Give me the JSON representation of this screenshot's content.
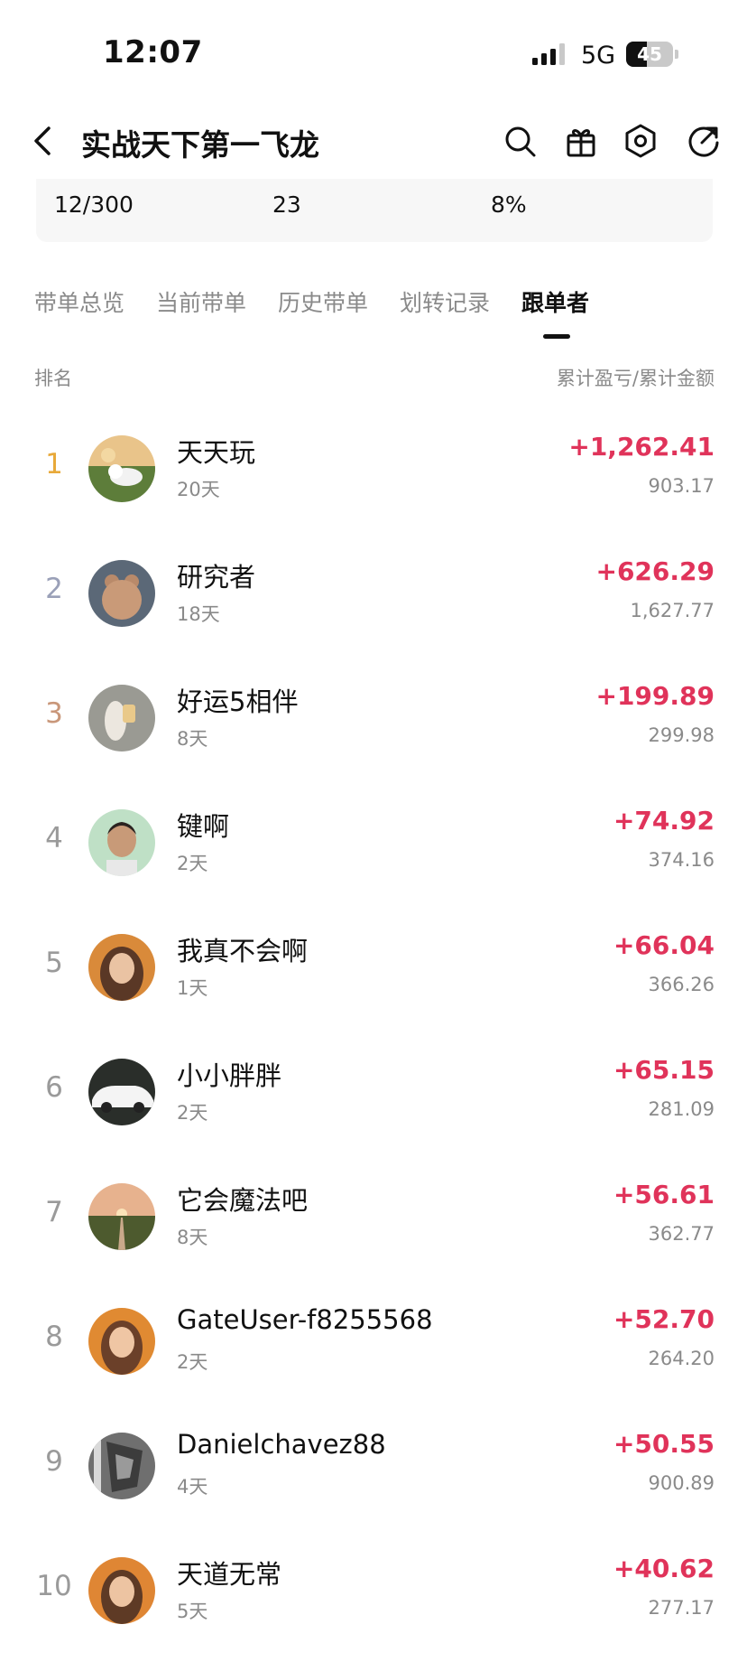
{
  "status_bar": {
    "time": "12:07",
    "network": "5G",
    "battery": "45",
    "battery_level": 0.45
  },
  "header": {
    "title": "实战天下第一飞龙",
    "icons": [
      "back-icon",
      "search-icon",
      "gift-icon",
      "settings-icon",
      "share-icon"
    ]
  },
  "stats": {
    "values": [
      "12/300",
      "23",
      "8%"
    ]
  },
  "tabs": [
    {
      "label": "带单总览",
      "active": false
    },
    {
      "label": "当前带单",
      "active": false
    },
    {
      "label": "历史带单",
      "active": false
    },
    {
      "label": "划转记录",
      "active": false
    },
    {
      "label": "跟单者",
      "active": true
    }
  ],
  "columns": {
    "left": "排名",
    "right": "累计盈亏/累计金额"
  },
  "followers": [
    {
      "rank": "1",
      "name": "天天玩",
      "days": "20天",
      "pnl": "+1,262.41",
      "amount": "903.17"
    },
    {
      "rank": "2",
      "name": "研究者",
      "days": "18天",
      "pnl": "+626.29",
      "amount": "1,627.77"
    },
    {
      "rank": "3",
      "name": "好运5相伴",
      "days": "8天",
      "pnl": "+199.89",
      "amount": "299.98"
    },
    {
      "rank": "4",
      "name": "键啊",
      "days": "2天",
      "pnl": "+74.92",
      "amount": "374.16"
    },
    {
      "rank": "5",
      "name": "我真不会啊",
      "days": "1天",
      "pnl": "+66.04",
      "amount": "366.26"
    },
    {
      "rank": "6",
      "name": "小小胖胖",
      "days": "2天",
      "pnl": "+65.15",
      "amount": "281.09"
    },
    {
      "rank": "7",
      "name": "它会魔法吧",
      "days": "8天",
      "pnl": "+56.61",
      "amount": "362.77"
    },
    {
      "rank": "8",
      "name": "GateUser-f8255568",
      "days": "2天",
      "pnl": "+52.70",
      "amount": "264.20"
    },
    {
      "rank": "9",
      "name": "Danielchavez88",
      "days": "4天",
      "pnl": "+50.55",
      "amount": "900.89"
    },
    {
      "rank": "10",
      "name": "天道无常",
      "days": "5天",
      "pnl": "+40.62",
      "amount": "277.17"
    }
  ],
  "colors": {
    "rank_gold": "#e8a93a",
    "rank_silver": "#9aa0b8",
    "rank_bronze": "#c9977a",
    "rank_default": "#9a9a9a",
    "profit": "#e0335a"
  }
}
